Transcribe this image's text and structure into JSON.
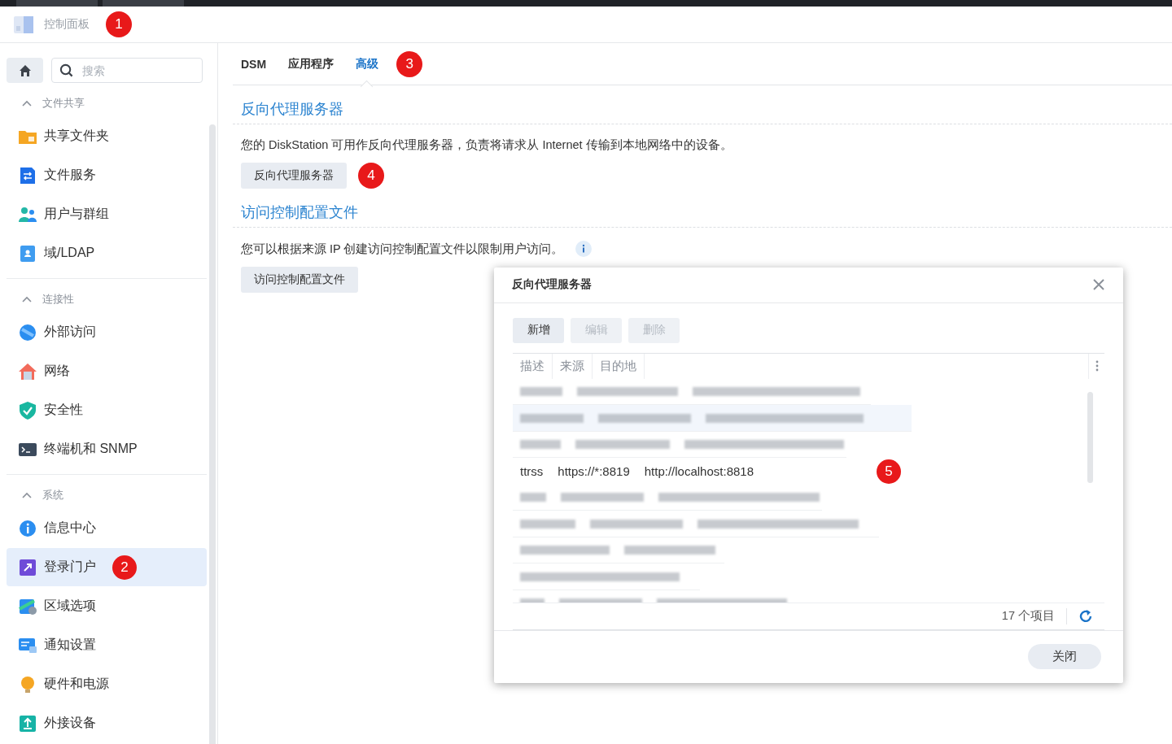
{
  "header": {
    "title": "控制面板",
    "annotation": "1"
  },
  "sidebar": {
    "search": {
      "placeholder": "搜索"
    },
    "sections": [
      {
        "title": "文件共享",
        "expanded": true,
        "items": [
          {
            "label": "共享文件夹",
            "selected": false
          },
          {
            "label": "文件服务",
            "selected": false
          },
          {
            "label": "用户与群组",
            "selected": false
          },
          {
            "label": "域/LDAP",
            "selected": false
          }
        ]
      },
      {
        "title": "连接性",
        "expanded": true,
        "items": [
          {
            "label": "外部访问",
            "selected": false
          },
          {
            "label": "网络",
            "selected": false
          },
          {
            "label": "安全性",
            "selected": false
          },
          {
            "label": "终端机和 SNMP",
            "selected": false
          }
        ]
      },
      {
        "title": "系统",
        "expanded": true,
        "items": [
          {
            "label": "信息中心",
            "selected": false
          },
          {
            "label": "登录门户",
            "selected": true,
            "annotation": "2"
          },
          {
            "label": "区域选项",
            "selected": false
          },
          {
            "label": "通知设置",
            "selected": false
          },
          {
            "label": "硬件和电源",
            "selected": false
          },
          {
            "label": "外接设备",
            "selected": false
          }
        ]
      }
    ]
  },
  "tabs": [
    {
      "label": "DSM",
      "selected": false
    },
    {
      "label": "应用程序",
      "selected": false
    },
    {
      "label": "高级",
      "selected": true,
      "annotation": "3"
    }
  ],
  "sections": [
    {
      "title": "反向代理服务器",
      "description": "您的 DiskStation 可用作反向代理服务器，负责将请求从 Internet 传输到本地网络中的设备。",
      "info": false,
      "button": "反向代理服务器",
      "annotation": "4"
    },
    {
      "title": "访问控制配置文件",
      "description": "您可以根据来源 IP 创建访问控制配置文件以限制用户访问。",
      "info": true,
      "button": "访问控制配置文件"
    }
  ],
  "dialog": {
    "title": "反向代理服务器",
    "toolbar": [
      {
        "label": "新增",
        "disabled": false
      },
      {
        "label": "编辑",
        "disabled": true
      },
      {
        "label": "删除",
        "disabled": true
      }
    ],
    "columns": [
      "描述",
      "来源",
      "目的地"
    ],
    "rows": [
      {
        "kind": "redacted",
        "selected": false
      },
      {
        "kind": "redacted",
        "selected": true
      },
      {
        "kind": "redacted",
        "selected": false
      },
      {
        "kind": "entry",
        "selected": false,
        "cells": [
          "ttrss",
          "https://*:8819",
          "http://localhost:8818"
        ],
        "annotation": "5"
      },
      {
        "kind": "redacted",
        "selected": false
      },
      {
        "kind": "redacted",
        "selected": false
      },
      {
        "kind": "redacted",
        "selected": false
      },
      {
        "kind": "redacted",
        "selected": false
      },
      {
        "kind": "redacted",
        "selected": false
      }
    ],
    "count": "17 个项目",
    "close_button": "关闭"
  }
}
